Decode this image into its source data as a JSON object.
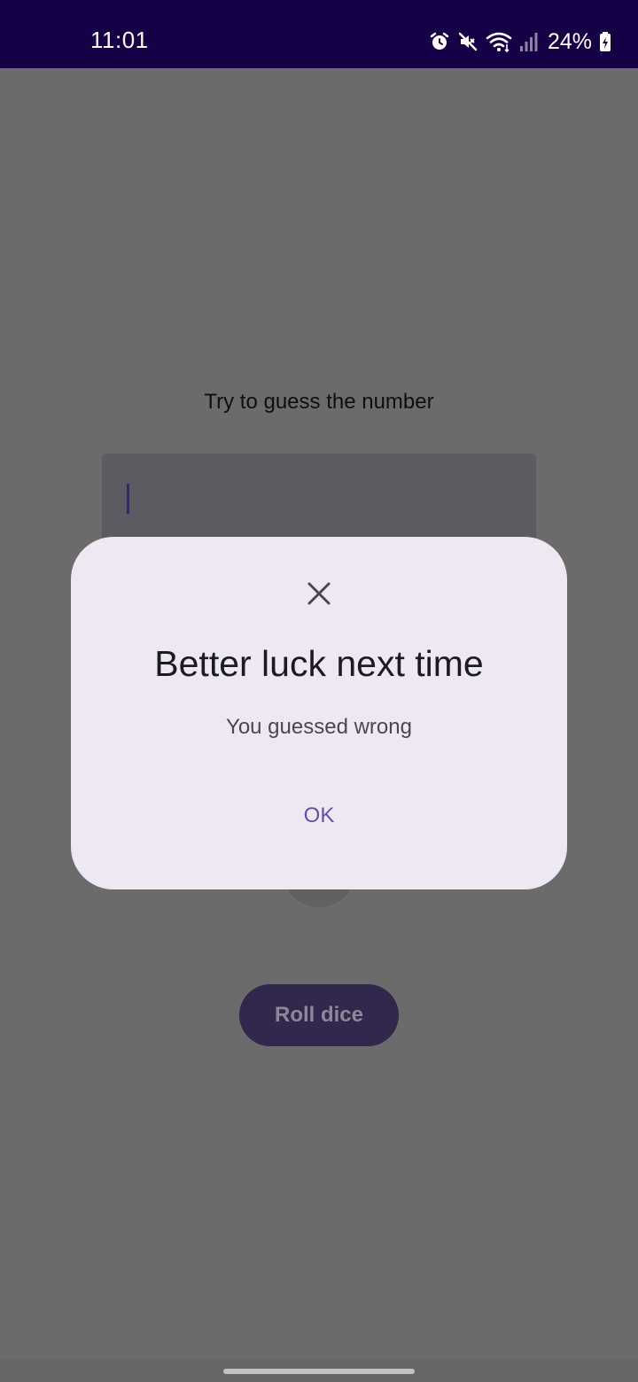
{
  "status_bar": {
    "time": "11:01",
    "battery": "24%",
    "icons": [
      "alarm-icon",
      "mute-icon",
      "wifi-icon",
      "signal-icon",
      "battery-charging-icon"
    ]
  },
  "main": {
    "prompt": "Try to guess the number",
    "input_value": "",
    "roll_button_label": "Roll dice"
  },
  "dialog": {
    "close_icon": "close-icon",
    "title": "Better luck next time",
    "message": "You guessed wrong",
    "ok_label": "OK"
  },
  "colors": {
    "status_bar": "#160046",
    "scrim": "#6b6b6b",
    "dialog_bg": "#eee8f3",
    "accent": "#6750a4",
    "button_dim": "#32274d"
  }
}
